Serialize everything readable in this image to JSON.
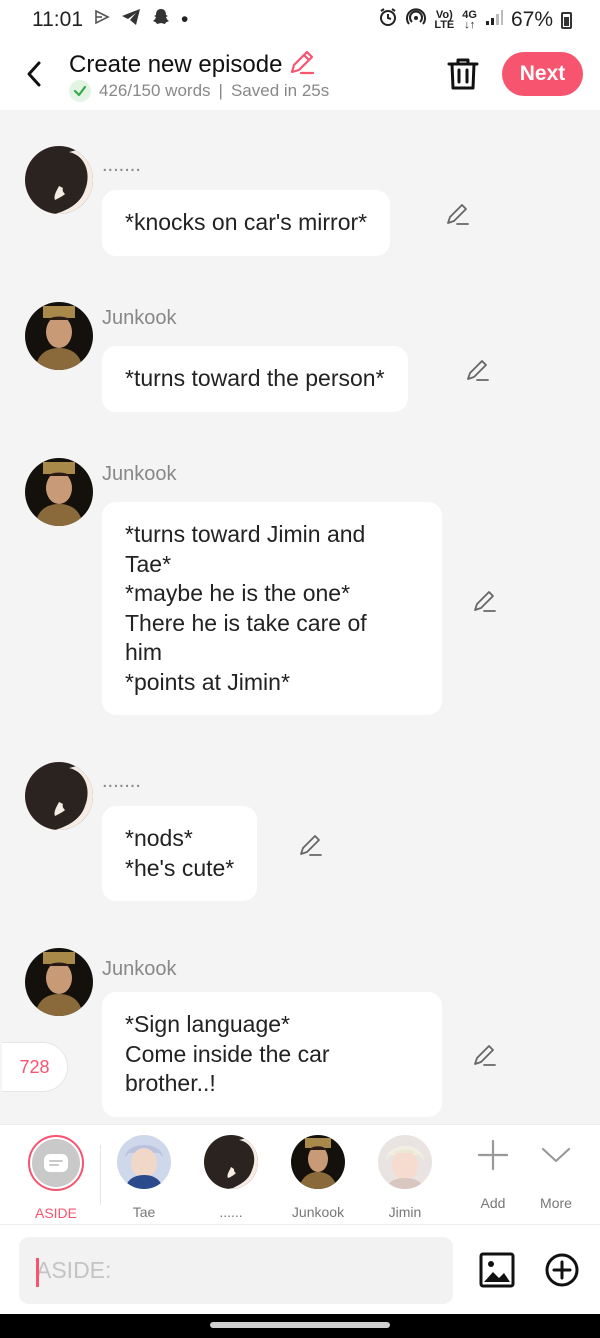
{
  "status_bar": {
    "time": "11:01",
    "dot": "•",
    "network_top": "Vo)",
    "network_bottom": "LTE",
    "gen_top": "4G",
    "gen_bottom": "↓↑",
    "battery": "67%"
  },
  "header": {
    "title": "Create new episode",
    "word_count": "426/150 words",
    "separator": "|",
    "saved": "Saved in 25s",
    "next_label": "Next"
  },
  "messages": [
    {
      "speaker": ".......",
      "avatar": "silhouette-avatar",
      "text": "*knocks on car's mirror*"
    },
    {
      "speaker": "Junkook",
      "avatar": "junkook-avatar",
      "text": "*turns toward the person*"
    },
    {
      "speaker": "Junkook",
      "avatar": "junkook-avatar",
      "text": "*turns toward Jimin and\nTae*\n*maybe he is the one*\nThere he is take care of\nhim\n*points at Jimin*"
    },
    {
      "speaker": ".......",
      "avatar": "silhouette-avatar",
      "text": "*nods*\n*he's cute*"
    },
    {
      "speaker": "Junkook",
      "avatar": "junkook-avatar",
      "text": "*Sign language*\nCome inside the car\nbrother..!"
    }
  ],
  "counter": "728",
  "characters": [
    {
      "label": "ASIDE",
      "selected": true
    },
    {
      "label": "Tae"
    },
    {
      "label": "......"
    },
    {
      "label": "Junkook"
    },
    {
      "label": "Jimin"
    },
    {
      "label": "Add"
    },
    {
      "label": "More"
    }
  ],
  "input": {
    "placeholder": "ASIDE:"
  },
  "colors": {
    "accent": "#f7546f",
    "background": "#f4f4f4",
    "bubble": "#ffffff",
    "muted": "#888888"
  }
}
